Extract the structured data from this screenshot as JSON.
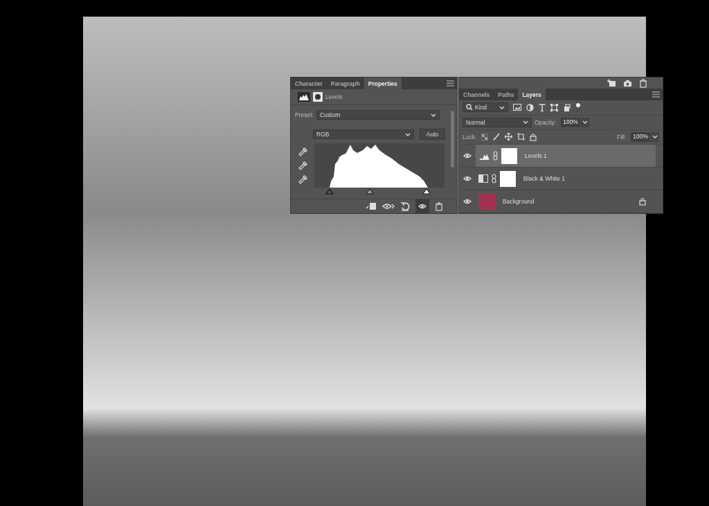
{
  "properties_panel": {
    "tabs": [
      {
        "label": "Character",
        "selected": false
      },
      {
        "label": "Paragraph",
        "selected": false
      },
      {
        "label": "Properties",
        "selected": true
      }
    ],
    "adjustment": "Levels",
    "preset_label": "Preset:",
    "preset": "Custom",
    "channel": "RGB",
    "auto_button": "Auto"
  },
  "layers_panel": {
    "tabs": [
      {
        "label": "Channels",
        "selected": false
      },
      {
        "label": "Paths",
        "selected": false
      },
      {
        "label": "Layers",
        "selected": true
      }
    ],
    "filter": "Kind",
    "blend_mode": "Normal",
    "opacity_label": "Opacity:",
    "opacity": "100%",
    "lock_label": "Lock:",
    "fill_label": "Fill:",
    "fill": "100%",
    "layers": [
      {
        "name": "Levels 1",
        "kind": "levels",
        "selected": true,
        "visible": true,
        "locked": false
      },
      {
        "name": "Black & White 1",
        "kind": "black_white",
        "selected": false,
        "visible": true,
        "locked": false
      },
      {
        "name": "Background",
        "kind": "image",
        "selected": false,
        "visible": true,
        "locked": true
      }
    ]
  }
}
